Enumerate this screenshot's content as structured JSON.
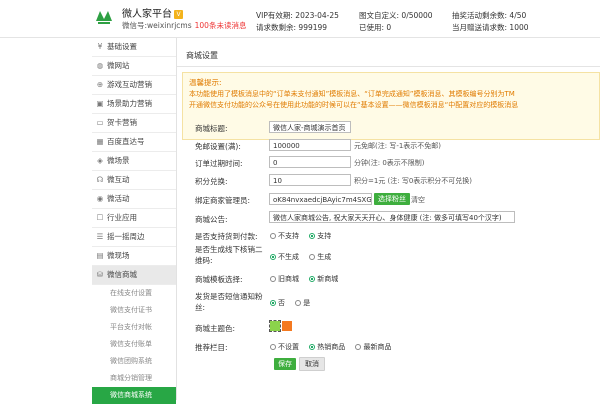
{
  "header": {
    "brand": "微人家平台",
    "vip_badge": "V",
    "wechat_id": "微信号:weixinrjcms",
    "unread_text": "100条未读消息",
    "stats": [
      {
        "label": "VIP有效期:",
        "value": "2023-04-25"
      },
      {
        "label": "图文自定义:",
        "value": "0/50000"
      },
      {
        "label": "抽奖活动剩余数:",
        "value": "4/50"
      },
      {
        "label": "请求数剩余:",
        "value": "999199"
      },
      {
        "label": "已使用:",
        "value": "0"
      },
      {
        "label": "当月赠送请求数:",
        "value": "1000"
      }
    ]
  },
  "sidebar": {
    "items": [
      {
        "label": "基础设置",
        "icon": "tools-icon"
      },
      {
        "label": "微网站",
        "icon": "globe-icon"
      },
      {
        "label": "游戏互动营销",
        "icon": "gamepad-icon"
      },
      {
        "label": "场景助力营销",
        "icon": "scene-icon"
      },
      {
        "label": "贺卡营销",
        "icon": "card-icon"
      },
      {
        "label": "百度直达号",
        "icon": "baidu-icon"
      },
      {
        "label": "微场景",
        "icon": "scene-icon"
      },
      {
        "label": "微互动",
        "icon": "interact-icon"
      },
      {
        "label": "微活动",
        "icon": "activity-icon"
      },
      {
        "label": "行业应用",
        "icon": "industry-icon"
      },
      {
        "label": "摇一摇周边",
        "icon": "shake-icon"
      },
      {
        "label": "微现场",
        "icon": "live-icon"
      },
      {
        "label": "微信商城",
        "icon": "cart-icon"
      }
    ],
    "sub_items": [
      {
        "label": "在线支付设置"
      },
      {
        "label": "微信支付证书"
      },
      {
        "label": "平台支付对帐"
      },
      {
        "label": "微信支付账单"
      },
      {
        "label": "微信团购系统"
      },
      {
        "label": "商城分销管理"
      },
      {
        "label": "微信商城系统"
      }
    ]
  },
  "main": {
    "page_title": "商城设置",
    "notice_title": "温馨提示:",
    "notice_line1": "本功能使用了模板消息中的“订单未支付通知”模板消息、“订单完成通知”模板消息、其模板编号分别为TM",
    "notice_line2": "开通微信支付功能的公众号在使用此功能的时候可以在“基本设置——微信模板消息“中配置对应的模板消息"
  },
  "form": {
    "title_label": "商城标题:",
    "title_value": "微信人家-商城演示首页",
    "shipping_label": "免邮设置(满):",
    "shipping_value": "100000",
    "shipping_hint": "元免邮(注: 写-1表示不免邮)",
    "expire_label": "订单过期时间:",
    "expire_value": "0",
    "expire_hint": "分钟(注: 0表示不限制)",
    "points_label": "积分兑换:",
    "points_value": "10",
    "points_hint": "积分=1元 (注: 写0表示积分不可兑换)",
    "admin_label": "绑定商家管理员:",
    "admin_value": "oK84nvxaedcjBAyic7m4SXGIl",
    "admin_select": "选择粉丝",
    "admin_clear": "清空",
    "notice_label": "商城公告:",
    "notice_value": "微信人家商城公告, 祝大家天天开心、身体健康 (注: 做多可填写40个汉字)",
    "cod_label": "是否支持货到付款:",
    "cod_options": [
      "不支持",
      "支持"
    ],
    "cod_selected": 1,
    "verify_label_1": "是否生成线下核销二",
    "verify_label_2": "维码:",
    "verify_options": [
      "不生成",
      "生成"
    ],
    "verify_selected": 0,
    "template_label": "商城模板选择:",
    "template_options": [
      "旧商城",
      "新商城"
    ],
    "template_selected": 1,
    "sms_label_1": "发货是否短信通知粉",
    "sms_label_2": "丝:",
    "sms_options": [
      "否",
      "是"
    ],
    "sms_selected": 0,
    "color_label": "商城主题色:",
    "theme_colors": [
      "#8bd34b",
      "#f47920"
    ],
    "recommend_label": "推荐栏目:",
    "recommend_options": [
      "不设置",
      "热销商品",
      "最新商品"
    ],
    "recommend_selected": 1,
    "save_label": "保存",
    "cancel_label": "取消"
  }
}
